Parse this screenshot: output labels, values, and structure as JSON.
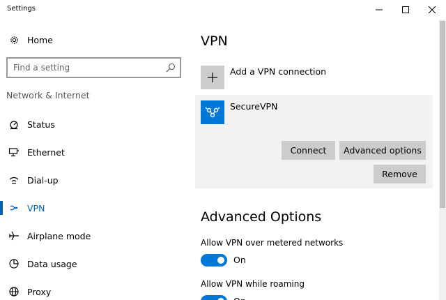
{
  "window": {
    "title": "Settings"
  },
  "sidebar": {
    "home_label": "Home",
    "search_placeholder": "Find a setting",
    "section_label": "Network & Internet",
    "items": [
      {
        "label": "Status",
        "icon": "status-icon",
        "selected": false
      },
      {
        "label": "Ethernet",
        "icon": "ethernet-icon",
        "selected": false
      },
      {
        "label": "Dial-up",
        "icon": "dial-up-icon",
        "selected": false
      },
      {
        "label": "VPN",
        "icon": "vpn-icon",
        "selected": true
      },
      {
        "label": "Airplane mode",
        "icon": "airplane-icon",
        "selected": false
      },
      {
        "label": "Data usage",
        "icon": "data-usage-icon",
        "selected": false
      },
      {
        "label": "Proxy",
        "icon": "proxy-icon",
        "selected": false
      }
    ]
  },
  "main": {
    "title": "VPN",
    "add_connection_label": "Add a VPN connection",
    "connection": {
      "name": "SecureVPN",
      "connect_label": "Connect",
      "advanced_label": "Advanced options",
      "remove_label": "Remove"
    },
    "advanced": {
      "title": "Advanced Options",
      "settings": [
        {
          "label": "Allow VPN over metered networks",
          "state": "On"
        },
        {
          "label": "Allow VPN while roaming",
          "state": "On"
        }
      ]
    }
  },
  "colors": {
    "accent": "#0078d7",
    "selected_text": "#0063b1",
    "button_bg": "#cccccc",
    "card_bg": "#f2f2f2"
  }
}
